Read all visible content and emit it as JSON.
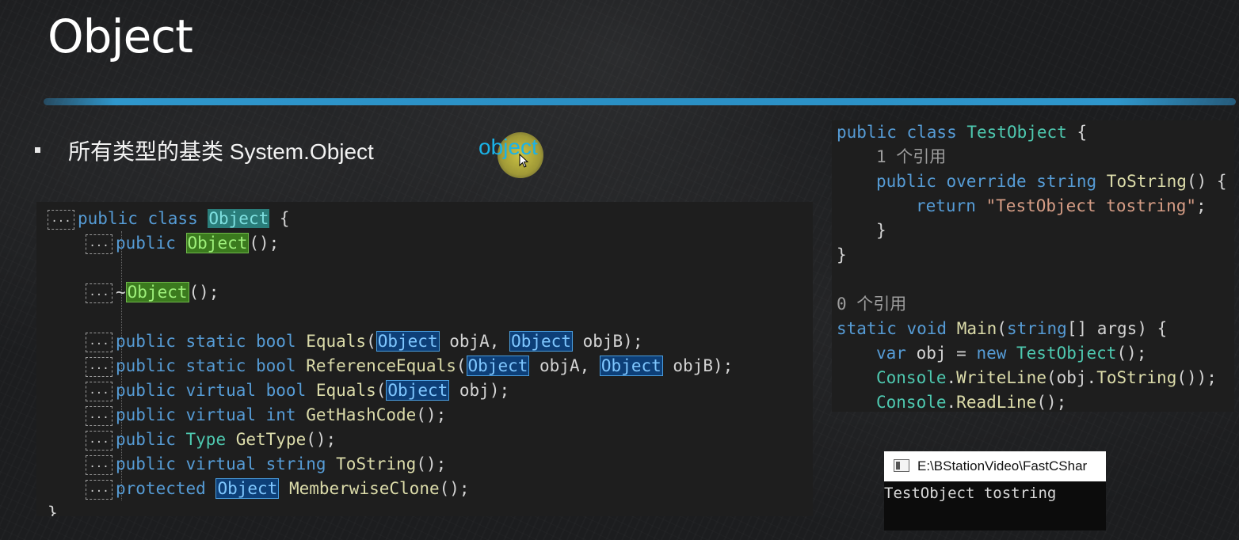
{
  "slide": {
    "title": "Object",
    "bullet": "所有类型的基类  System.Object",
    "keyword_note": "object"
  },
  "left_code": {
    "fold_marker": "...",
    "lines": [
      {
        "parts": [
          [
            "kw",
            "public class "
          ],
          [
            "hl-teal",
            "Object"
          ],
          [
            "pl",
            " {"
          ]
        ]
      },
      {
        "parts": [
          [
            "kw",
            "public "
          ],
          [
            "hl-green",
            "Object"
          ],
          [
            "pl",
            "();"
          ]
        ]
      },
      {
        "parts": []
      },
      {
        "parts": [
          [
            "pl",
            "~"
          ],
          [
            "hl-green",
            "Object"
          ],
          [
            "pl",
            "();"
          ]
        ]
      },
      {
        "parts": []
      },
      {
        "parts": [
          [
            "kw",
            "public static bool "
          ],
          [
            "fn",
            "Equals"
          ],
          [
            "pl",
            "("
          ],
          [
            "hl-blue",
            "Object"
          ],
          [
            "pl",
            " objA, "
          ],
          [
            "hl-blue",
            "Object"
          ],
          [
            "pl",
            " objB);"
          ]
        ]
      },
      {
        "parts": [
          [
            "kw",
            "public static bool "
          ],
          [
            "fn",
            "ReferenceEquals"
          ],
          [
            "pl",
            "("
          ],
          [
            "hl-blue",
            "Object"
          ],
          [
            "pl",
            " objA, "
          ],
          [
            "hl-blue",
            "Object"
          ],
          [
            "pl",
            " objB);"
          ]
        ]
      },
      {
        "parts": [
          [
            "kw",
            "public virtual bool "
          ],
          [
            "fn",
            "Equals"
          ],
          [
            "pl",
            "("
          ],
          [
            "hl-blue",
            "Object"
          ],
          [
            "pl",
            " obj);"
          ]
        ]
      },
      {
        "parts": [
          [
            "kw",
            "public virtual int "
          ],
          [
            "fn",
            "GetHashCode"
          ],
          [
            "pl",
            "();"
          ]
        ]
      },
      {
        "parts": [
          [
            "kw",
            "public "
          ],
          [
            "ty",
            "Type "
          ],
          [
            "fn",
            "GetType"
          ],
          [
            "pl",
            "();"
          ]
        ]
      },
      {
        "parts": [
          [
            "kw",
            "public virtual string "
          ],
          [
            "fn",
            "ToString"
          ],
          [
            "pl",
            "();"
          ]
        ]
      },
      {
        "parts": [
          [
            "kw",
            "protected "
          ],
          [
            "hl-blue",
            "Object"
          ],
          [
            "pl",
            " "
          ],
          [
            "fn",
            "MemberwiseClone"
          ],
          [
            "pl",
            "();"
          ]
        ]
      },
      {
        "parts": [
          [
            "pl",
            "}"
          ]
        ]
      }
    ]
  },
  "right_code": {
    "lines": [
      {
        "indent": 0,
        "parts": [
          [
            "kw",
            "public class "
          ],
          [
            "ty",
            "TestObject"
          ],
          [
            "pl",
            " {"
          ]
        ]
      },
      {
        "indent": 1,
        "parts": [
          [
            "ref",
            "1 个引用"
          ]
        ]
      },
      {
        "indent": 1,
        "parts": [
          [
            "kw",
            "public override string "
          ],
          [
            "fn",
            "ToString"
          ],
          [
            "pl",
            "() {"
          ]
        ]
      },
      {
        "indent": 2,
        "parts": [
          [
            "kw",
            "return "
          ],
          [
            "str",
            "\"TestObject tostring\""
          ],
          [
            "pl",
            ";"
          ]
        ]
      },
      {
        "indent": 1,
        "parts": [
          [
            "pl",
            "}"
          ]
        ]
      },
      {
        "indent": 0,
        "parts": [
          [
            "pl",
            "}"
          ]
        ]
      },
      {
        "indent": 0,
        "parts": []
      },
      {
        "indent": 0,
        "parts": [
          [
            "ref",
            "0 个引用"
          ]
        ]
      },
      {
        "indent": 0,
        "parts": [
          [
            "kw",
            "static void "
          ],
          [
            "fn",
            "Main"
          ],
          [
            "pl",
            "("
          ],
          [
            "kw",
            "string"
          ],
          [
            "pl",
            "[] args) {"
          ]
        ]
      },
      {
        "indent": 1,
        "parts": [
          [
            "kw",
            "var "
          ],
          [
            "pl",
            "obj = "
          ],
          [
            "kw",
            "new "
          ],
          [
            "ty",
            "TestObject"
          ],
          [
            "pl",
            "();"
          ]
        ]
      },
      {
        "indent": 1,
        "parts": [
          [
            "ty",
            "Console"
          ],
          [
            "pl",
            "."
          ],
          [
            "fn",
            "WriteLine"
          ],
          [
            "pl",
            "(obj."
          ],
          [
            "fn",
            "ToString"
          ],
          [
            "pl",
            "());"
          ]
        ]
      },
      {
        "indent": 1,
        "parts": [
          [
            "ty",
            "Console"
          ],
          [
            "pl",
            "."
          ],
          [
            "fn",
            "ReadLine"
          ],
          [
            "pl",
            "();"
          ]
        ]
      }
    ]
  },
  "console": {
    "title": "E:\\BStationVideo\\FastCShar",
    "output": "TestObject tostring"
  }
}
